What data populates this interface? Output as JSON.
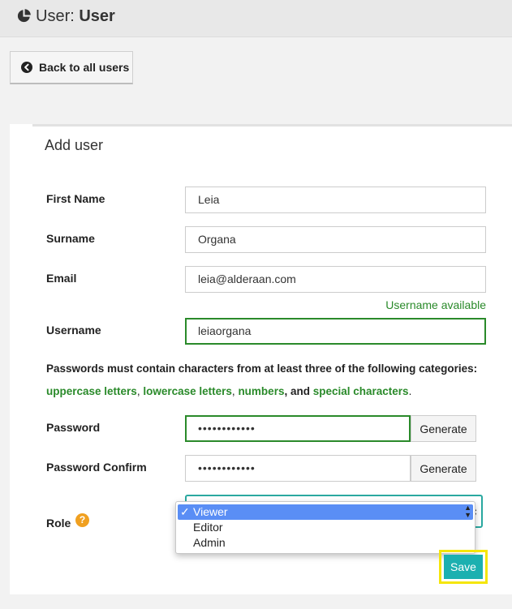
{
  "header": {
    "title_prefix": "User:",
    "title_name": "User",
    "icon": "pie-chart-icon"
  },
  "back_button": {
    "label": "Back to all users",
    "icon": "arrow-left-circle-icon"
  },
  "form": {
    "title": "Add user",
    "first_name": {
      "label": "First Name",
      "value": "Leia"
    },
    "surname": {
      "label": "Surname",
      "value": "Organa"
    },
    "email": {
      "label": "Email",
      "value": "leia@alderaan.com"
    },
    "username_status": "Username available",
    "username": {
      "label": "Username",
      "value": "leiaorgana"
    },
    "password_rules": {
      "intro": "Passwords must contain characters from at least three of the following categories:",
      "cat1": "uppercase letters",
      "sep1": ",",
      "cat2": "lowercase letters",
      "sep2": ",",
      "cat3": "numbers",
      "sep3": ", and",
      "cat4": "special characters",
      "end": "."
    },
    "password": {
      "label": "Password",
      "value": "••••••••••••",
      "generate_label": "Generate"
    },
    "password_confirm": {
      "label": "Password Confirm",
      "value": "••••••••••••",
      "generate_label": "Generate"
    },
    "role": {
      "label": "Role",
      "help_icon": "question-circle-icon",
      "options": [
        "Viewer",
        "Editor",
        "Admin"
      ],
      "selected": "Viewer",
      "checkmark": "✓"
    },
    "save_label": "Save"
  },
  "colors": {
    "success_green": "#2a8a2a",
    "teal": "#1cb0b0",
    "highlight_yellow": "#f5e60a",
    "select_blue": "#5a8ef5"
  }
}
